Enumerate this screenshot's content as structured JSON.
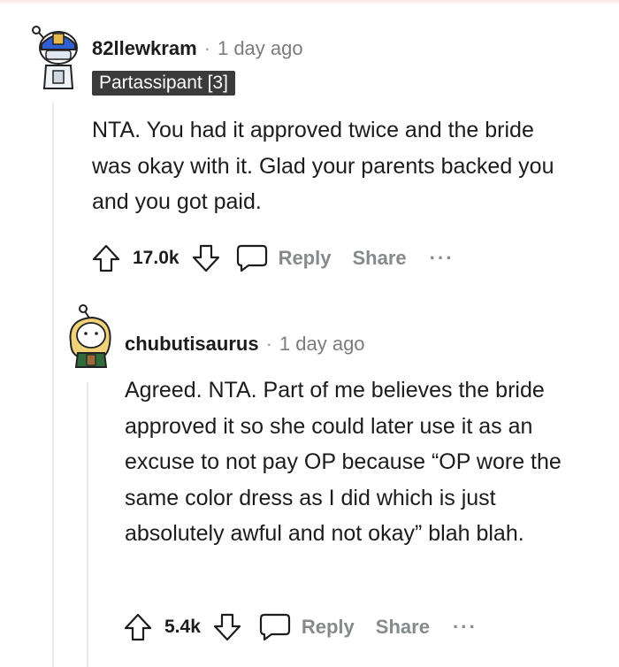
{
  "comments": [
    {
      "username": "82llewkram",
      "separator": "·",
      "time": "1 day ago",
      "flair": "Partassipant [3]",
      "body": "NTA. You had it approved twice and the bride was okay with it. Glad your parents backed you and you got paid.",
      "score": "17.0k",
      "reply_label": "Reply",
      "share_label": "Share",
      "more_label": "···"
    },
    {
      "username": "chubutisaurus",
      "separator": "·",
      "time": "1 day ago",
      "body": "Agreed. NTA. Part of me believes the bride approved it so she could later use it as an excuse to not pay OP because “OP wore the same color dress as I did which is just absolutely awful and not okay” blah blah.",
      "score": "5.4k",
      "reply_label": "Reply",
      "share_label": "Share",
      "more_label": "···"
    }
  ],
  "colors": {
    "text": "#1c1c1c",
    "muted": "#878a8c",
    "flair_bg": "#3b3b3b",
    "thread_line": "#eaeaea"
  }
}
